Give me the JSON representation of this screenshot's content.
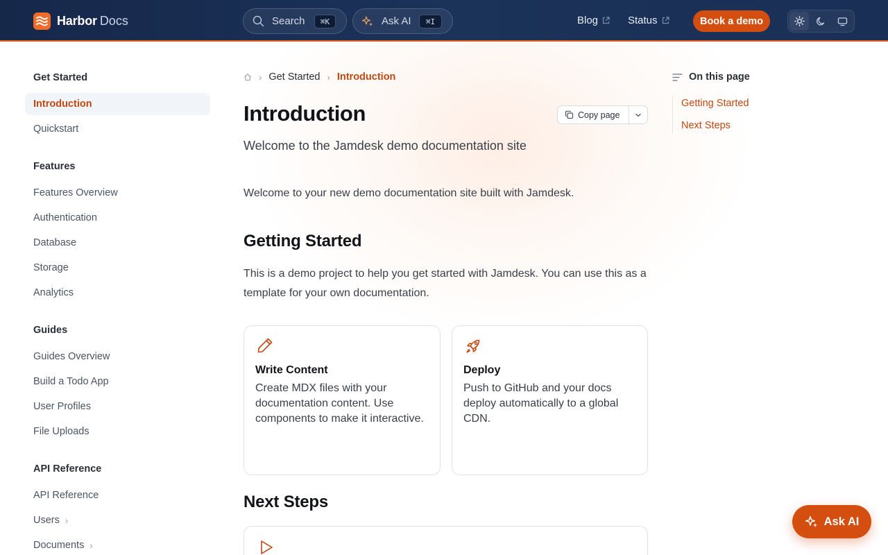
{
  "header": {
    "brand_name": "Harbor",
    "brand_suffix": "Docs",
    "search_label": "Search",
    "search_shortcut": "⌘K",
    "ask_ai_label": "Ask AI",
    "ask_ai_shortcut": "⌘I",
    "links": [
      {
        "label": "Blog",
        "icon": "external-link-icon"
      },
      {
        "label": "Status",
        "icon": "external-link-icon"
      }
    ],
    "cta_label": "Book a demo",
    "theme_options": [
      "light-icon",
      "moon-icon",
      "monitor-icon"
    ],
    "theme_selected": "light"
  },
  "sidebar": {
    "sections": [
      {
        "title": "Get Started",
        "items": [
          {
            "label": "Introduction",
            "active": true
          },
          {
            "label": "Quickstart"
          }
        ]
      },
      {
        "title": "Features",
        "items": [
          {
            "label": "Features Overview"
          },
          {
            "label": "Authentication"
          },
          {
            "label": "Database"
          },
          {
            "label": "Storage"
          },
          {
            "label": "Analytics"
          }
        ]
      },
      {
        "title": "Guides",
        "items": [
          {
            "label": "Guides Overview"
          },
          {
            "label": "Build a Todo App"
          },
          {
            "label": "User Profiles"
          },
          {
            "label": "File Uploads"
          }
        ]
      },
      {
        "title": "API Reference",
        "items": [
          {
            "label": "API Reference"
          },
          {
            "label": "Users",
            "expandable": true
          },
          {
            "label": "Documents",
            "expandable": true
          }
        ]
      }
    ]
  },
  "breadcrumb": {
    "home_icon": "home-icon",
    "items": [
      "Get Started",
      "Introduction"
    ]
  },
  "main": {
    "title": "Introduction",
    "copy_label": "Copy page",
    "subtitle": "Welcome to the Jamdesk demo documentation site",
    "intro": "Welcome to your new demo documentation site built with Jamdesk.",
    "getting_started_heading": "Getting Started",
    "getting_started_body": "This is a demo project to help you get started with Jamdesk. You can use this as a template for your own documentation.",
    "cards": [
      {
        "icon": "pencil-icon",
        "title": "Write Content",
        "body": "Create MDX files with your documentation content. Use components to make it interactive."
      },
      {
        "icon": "rocket-icon",
        "title": "Deploy",
        "body": "Push to GitHub and your docs deploy automatically to a global CDN."
      }
    ],
    "next_steps_heading": "Next Steps",
    "next_card_icon": "play-icon"
  },
  "toc": {
    "title": "On this page",
    "items": [
      "Getting Started",
      "Next Steps"
    ]
  },
  "fab": {
    "label": "Ask AI"
  },
  "colors": {
    "accent": "#d44e10",
    "header_bg": "#16284a",
    "active_link": "#c2470f"
  }
}
